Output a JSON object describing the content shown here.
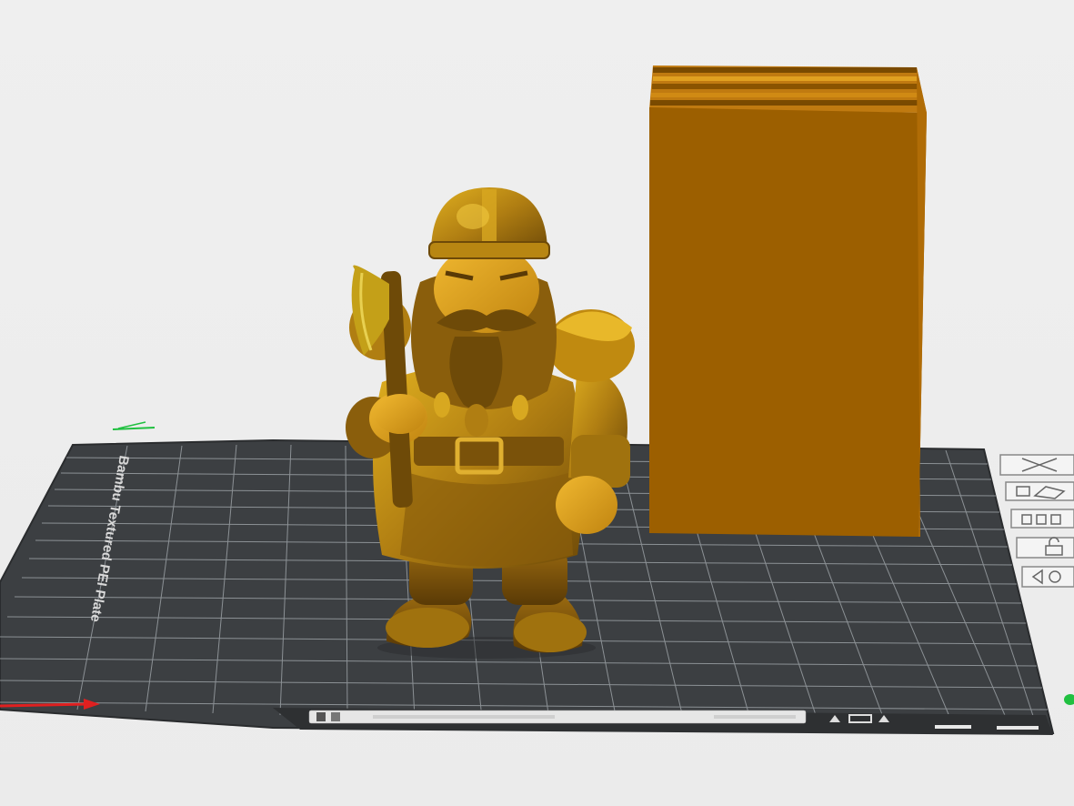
{
  "scene": {
    "plate_label": "Bambu Textured PEI Plate",
    "plate_name_text": "",
    "colors": {
      "background": "#eeeeee",
      "plate": "#3c3f42",
      "grid": "#9aa0a4",
      "model_primary": "#c08a10",
      "model_dark": "#6e4a08",
      "box_front": "#9c5f00",
      "box_top": "#c07a10",
      "x_axis": "#e02020",
      "y_axis": "#20c040"
    },
    "models": [
      {
        "name": "dwarf-warrior-figurine"
      },
      {
        "name": "wipe-tower"
      }
    ],
    "plate_toolbar_icons": [
      "close-icon",
      "auto-orient-icon",
      "arrange-icon",
      "lock-icon",
      "settings-icon"
    ],
    "plate_strip_icons": [
      "grid-select-icon",
      "object-list-icon",
      "plate-name-field",
      "home-icon",
      "view-icon",
      "up-icon"
    ]
  }
}
